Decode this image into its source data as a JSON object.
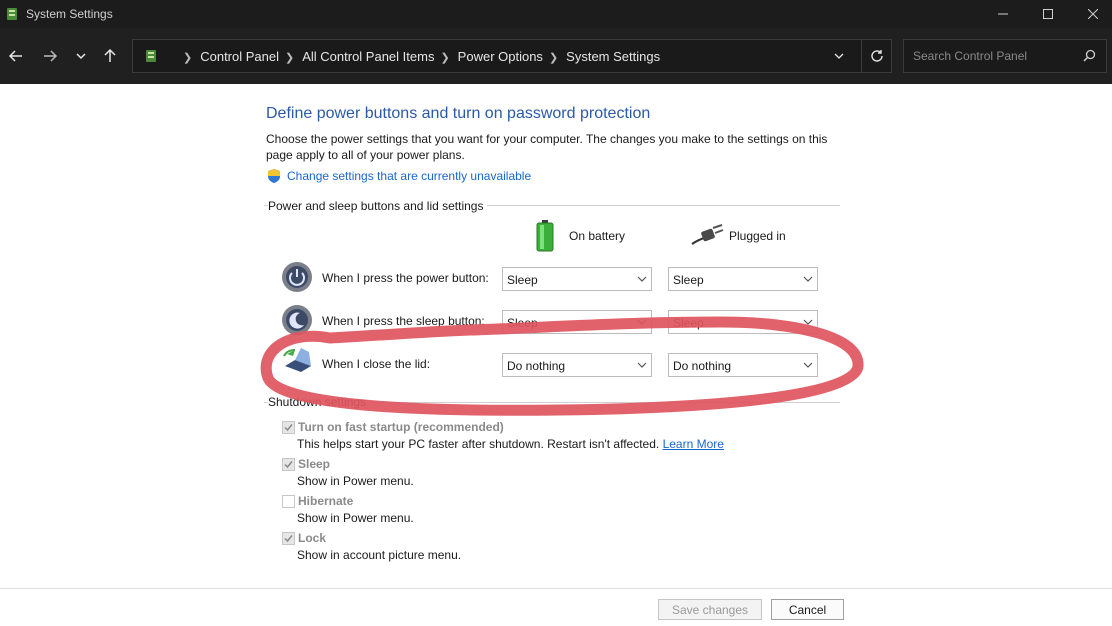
{
  "window": {
    "title": "System Settings",
    "controls": [
      "minimize-icon",
      "maximize-icon",
      "close-icon"
    ]
  },
  "addressbar": {
    "breadcrumbs": [
      "Control Panel",
      "All Control Panel Items",
      "Power Options",
      "System Settings"
    ],
    "search_placeholder": "Search Control Panel"
  },
  "main": {
    "heading": "Define power buttons and turn on password protection",
    "description": "Choose the power settings that you want for your computer. The changes you make to the settings on this page apply to all of your power plans.",
    "change_settings_link": "Change settings that are currently unavailable",
    "power_section_title": "Power and sleep buttons and lid settings",
    "columns": {
      "battery": "On battery",
      "plugged": "Plugged in"
    },
    "rows": [
      {
        "label": "When I press the power button:",
        "battery": "Sleep",
        "plugged": "Sleep"
      },
      {
        "label": "When I press the sleep button:",
        "battery": "Sleep",
        "plugged": "Sleep"
      },
      {
        "label": "When I close the lid:",
        "battery": "Do nothing",
        "plugged": "Do nothing"
      }
    ],
    "shutdown_section_title": "Shutdown settings",
    "shutdown_options": [
      {
        "label": "Turn on fast startup (recommended)",
        "desc": "This helps start your PC faster after shutdown. Restart isn't affected.",
        "link": "Learn More",
        "checked": true
      },
      {
        "label": "Sleep",
        "desc": "Show in Power menu.",
        "checked": true
      },
      {
        "label": "Hibernate",
        "desc": "Show in Power menu.",
        "checked": false
      },
      {
        "label": "Lock",
        "desc": "Show in account picture menu.",
        "checked": true
      }
    ]
  },
  "footer": {
    "save_label": "Save changes",
    "cancel_label": "Cancel"
  },
  "colors": {
    "heading": "#2a5aa7",
    "link": "#1a66cc",
    "annotation": "#e0555e",
    "titlebar": "#1c1c1c"
  }
}
